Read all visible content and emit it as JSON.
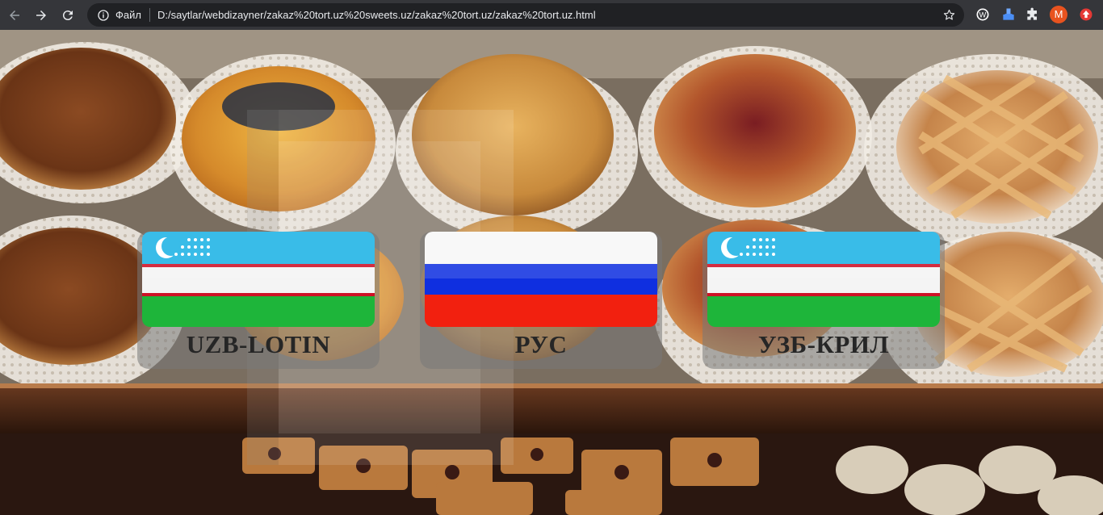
{
  "browser": {
    "scheme_label": "Файл",
    "url": "D:/saytlar/webdizayner/zakaz%20tort.uz%20sweets.uz/zakaz%20tort.uz/zakaz%20tort.uz.html",
    "profile_initial": "M",
    "icons": [
      "back-arrow-icon",
      "forward-arrow-icon",
      "reload-icon",
      "info-icon",
      "star-icon",
      "translate-extension-icon",
      "download-extension-icon",
      "puzzle-icon",
      "upload-extension-icon"
    ]
  },
  "languages": [
    {
      "label": "UZB-LOTIN",
      "flag": "uzbekistan"
    },
    {
      "label": "РУС",
      "flag": "russia"
    },
    {
      "label": "УЗБ-КРИЛ",
      "flag": "uzbekistan"
    }
  ],
  "colors": {
    "uz_blue": "#1eb3e5",
    "uz_red": "#ce1126",
    "uz_green": "#1eb53a",
    "ru_blue": "#0039a6",
    "ru_red": "#d52b1e",
    "chrome_bg": "#35363a"
  }
}
